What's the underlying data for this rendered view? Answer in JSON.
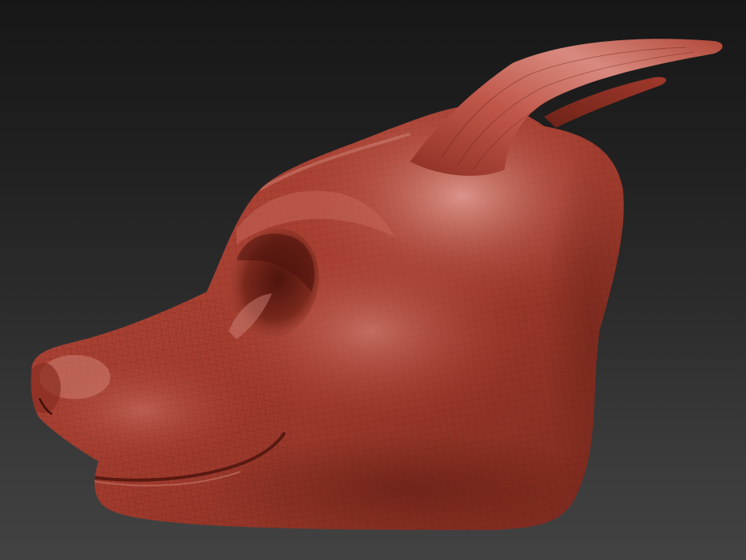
{
  "viewport": {
    "background_top": "#171717",
    "background_bottom": "#424242"
  },
  "model": {
    "subject": "sculpted-canine-head-with-horns",
    "wireframe_visible": true,
    "material_base_color": "#a13a2c",
    "material_highlight_color": "#d98a80",
    "material_shadow_color": "#5e1a12",
    "wire_color": "#6a1f16"
  }
}
